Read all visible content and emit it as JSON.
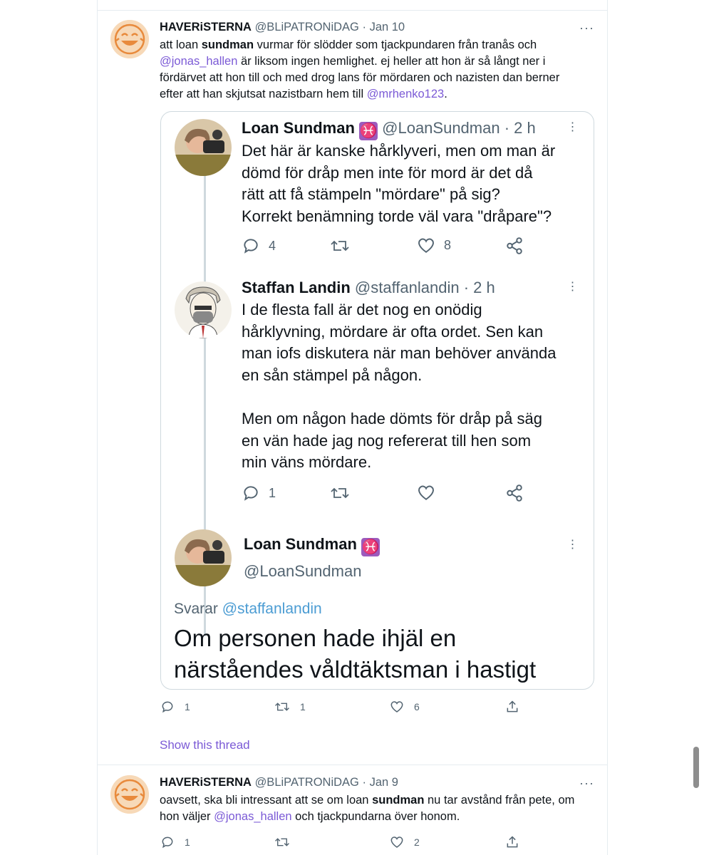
{
  "tweet1": {
    "name": "HAVERiSTERNA",
    "handle": "@BLiPATRONiDAG",
    "date": "· Jan 10",
    "more": "···",
    "text": {
      "p1": "att loan ",
      "b1": "sundman",
      "p2": " vurmar för slödder som tjackpundaren från tranås och",
      "m1": "@jonas_hallen",
      "p3": " är liksom ingen hemlighet. ej heller att hon är så långt ner i",
      "p4": "fördärvet att hon till och med drog lans för mördaren och nazisten dan berner",
      "p5": "efter att han skjutsat nazistbarn hem till ",
      "m2": "@mrhenko123",
      "p6": "."
    },
    "actions": {
      "replies": "1",
      "retweets": "1",
      "likes": "6"
    },
    "show_thread": "Show this thread"
  },
  "quote": {
    "t1": {
      "name": "Loan Sundman",
      "handle": "@LoanSundman",
      "time": "· 2 h",
      "lines": [
        "Det här är kanske hårklyveri, men om man är",
        "dömd för dråp men inte för mord är det då",
        "rätt att få stämpeln \"mördare\" på sig?",
        "Korrekt benämning torde väl vara \"dråpare\"?"
      ],
      "replies": "4",
      "likes": "8"
    },
    "t2": {
      "name": "Staffan Landin",
      "handle": "@staffanlandin",
      "time": "· 2 h",
      "lines1": [
        "I de flesta fall är det nog en onödig",
        "hårklyvning, mördare är ofta ordet. Sen kan",
        "man iofs diskutera när man behöver använda",
        "en sån stämpel på någon."
      ],
      "lines2": [
        "Men om någon hade dömts för dråp på säg",
        "en vän hade jag nog refererat till hen som",
        "min väns mördare."
      ],
      "replies": "1"
    },
    "t3": {
      "name": "Loan Sundman",
      "handle": "@LoanSundman",
      "replying": "Svarar ",
      "replying_to": "@staffanlandin",
      "lines": [
        "Om personen hade ihjäl en",
        "närståendes våldtäktsman i hastigt"
      ]
    }
  },
  "tweet2": {
    "name": "HAVERiSTERNA",
    "handle": "@BLiPATRONiDAG",
    "date": "· Jan 9",
    "more": "···",
    "text": {
      "p1": "oavsett, ska bli intressant att se om loan ",
      "b1": "sundman",
      "p2": " nu tar avstånd från pete, om",
      "p3": "hon väljer ",
      "m1": "@jonas_hallen",
      "p4": " och tjackpundarna över honom."
    },
    "actions": {
      "replies": "1",
      "likes": "2"
    }
  },
  "colors": {
    "link": "#7b5ad6",
    "muted": "#536471",
    "border": "#cfd9de",
    "quote_link": "#4b9cd3"
  }
}
